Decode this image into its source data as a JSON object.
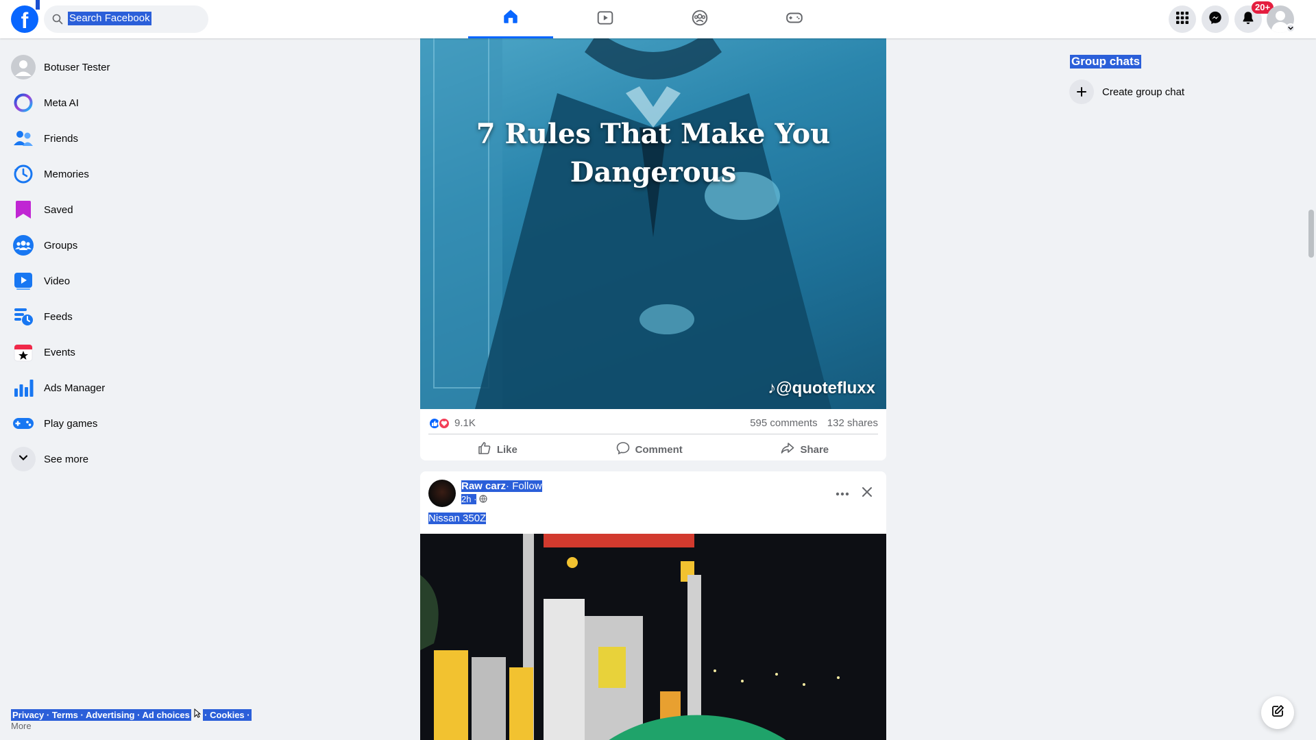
{
  "topbar": {
    "logo": "f",
    "search_placeholder": "Search Facebook",
    "search_value": "Search Facebook",
    "notification_badge": "20+",
    "nav_tabs": [
      "home",
      "video",
      "groups",
      "gaming"
    ],
    "accent": "#0866ff"
  },
  "sidebar": {
    "items": [
      {
        "label": "Botuser Tester",
        "icon": "avatar-icon"
      },
      {
        "label": "Meta AI",
        "icon": "meta-ai-icon"
      },
      {
        "label": "Friends",
        "icon": "friends-icon"
      },
      {
        "label": "Memories",
        "icon": "memories-icon"
      },
      {
        "label": "Saved",
        "icon": "saved-icon"
      },
      {
        "label": "Groups",
        "icon": "groups-icon"
      },
      {
        "label": "Video",
        "icon": "video-icon"
      },
      {
        "label": "Feeds",
        "icon": "feeds-icon"
      },
      {
        "label": "Events",
        "icon": "events-icon"
      },
      {
        "label": "Ads Manager",
        "icon": "ads-manager-icon"
      },
      {
        "label": "Play games",
        "icon": "play-games-icon"
      },
      {
        "label": "See more",
        "icon": "chevron-down-icon"
      }
    ]
  },
  "footer": {
    "links": "Privacy · Terms · Advertising · Ad choices",
    "cookies": "· Cookies ·",
    "more": "More"
  },
  "post1": {
    "caption_line1": "7 Rules That Make You",
    "caption_line2": "Dangerous",
    "watermark": "@quotefluxx",
    "reactions_count": "9.1K",
    "comments": "595 comments",
    "shares": "132 shares",
    "like_label": "Like",
    "comment_label": "Comment",
    "share_label": "Share"
  },
  "post2": {
    "author": "Raw carz",
    "follow": "· Follow",
    "time": "2h ·",
    "text": "Nissan 350Z"
  },
  "right": {
    "group_chats_title": "Group chats",
    "create_group_label": "Create group chat"
  }
}
